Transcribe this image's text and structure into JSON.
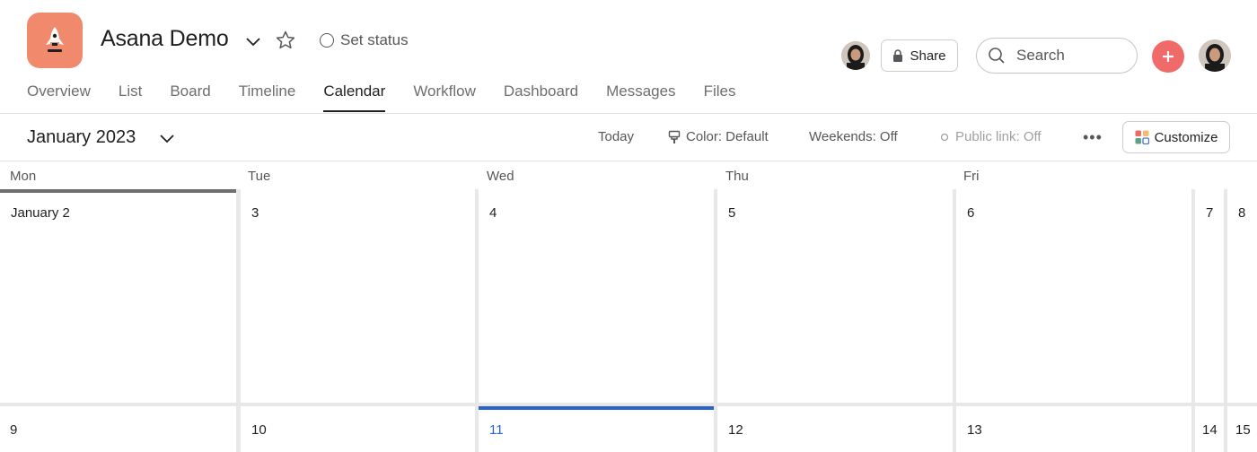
{
  "project": {
    "title": "Asana Demo",
    "set_status": "Set status",
    "icon": "rocket-icon",
    "brand_color": "#f1896c"
  },
  "header": {
    "share_label": "Share",
    "search_placeholder": "Search",
    "add_color": "#f06a6a"
  },
  "tabs": [
    {
      "label": "Overview"
    },
    {
      "label": "List"
    },
    {
      "label": "Board"
    },
    {
      "label": "Timeline"
    },
    {
      "label": "Calendar",
      "active": true
    },
    {
      "label": "Workflow"
    },
    {
      "label": "Dashboard"
    },
    {
      "label": "Messages"
    },
    {
      "label": "Files"
    }
  ],
  "toolbar": {
    "month": "January 2023",
    "today": "Today",
    "color": "Color: Default",
    "weekends": "Weekends: Off",
    "public_link": "Public link: Off",
    "more": "•••",
    "customize": "Customize"
  },
  "calendar": {
    "day_headers": [
      "Mon",
      "Tue",
      "Wed",
      "Thu",
      "Fri"
    ],
    "week1": [
      "January 2",
      "3",
      "4",
      "5",
      "6",
      "7",
      "8"
    ],
    "week2": [
      "9",
      "10",
      "11",
      "12",
      "13",
      "14",
      "15"
    ],
    "today_date": "11",
    "today_color": "#2962c9"
  }
}
